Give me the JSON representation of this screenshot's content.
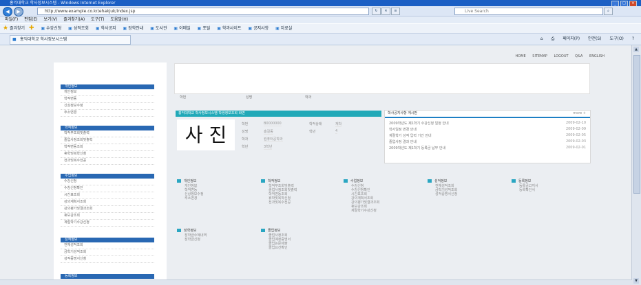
{
  "browser": {
    "title": "홍익대학교 학사정보시스템 - Windows Internet Explorer",
    "address": "http://www.example.co.kr/ehakjuk/index.jsp",
    "search_placeholder": "Live Search",
    "menu": [
      "파일(F)",
      "편집(E)",
      "보기(V)",
      "즐겨찾기(A)",
      "도구(T)",
      "도움말(H)"
    ],
    "favorites_label": "즐겨찾기",
    "favorites": [
      "수강신청",
      "성적조회",
      "학사공지",
      "장학안내",
      "도서관",
      "이메일",
      "포털",
      "학과사이트",
      "공지사항",
      "자료실"
    ],
    "tab_title": "홍익대학교 학사정보시스템",
    "tools": [
      "페이지(P)",
      "안전(S)",
      "도구(O)"
    ]
  },
  "page": {
    "top_links": [
      "HOME",
      "SITEMAP",
      "LOGOUT",
      "Q&A",
      "ENGLISH"
    ],
    "sidebar": [
      {
        "head": "개인정보",
        "items": [
          "개인정보",
          "학적변동",
          "신상정보수정",
          "주소변경"
        ]
      },
      {
        "head": "학적정보",
        "items": [
          "학적부조회및출력",
          "졸업사정조회및출력",
          "학적변동조회",
          "휴학및복학신청",
          "전과및복수전공"
        ]
      },
      {
        "head": "수업정보",
        "items": [
          "수강신청",
          "수강신청확인",
          "시간표조회",
          "강의계획서조회",
          "강의평가및결과조회",
          "휴보강조회",
          "계절학기수강신청"
        ]
      },
      {
        "head": "성적정보",
        "items": [
          "전체성적조회",
          "금학기성적조회",
          "성적증명서신청"
        ]
      },
      {
        "head": "등록정보",
        "items": []
      }
    ],
    "breadcrumb": [
      "학번",
      "성명",
      "학과"
    ],
    "profile": {
      "header": "홍익대학교 학사정보시스템 학생정보조회 화면",
      "photo_text": "사 진",
      "fields": [
        {
          "label": "학번",
          "value": "B0000000"
        },
        {
          "label": "성명",
          "value": "홍길동"
        },
        {
          "label": "학과",
          "value": "컴퓨터공학과"
        },
        {
          "label": "학년",
          "value": "3학년"
        }
      ],
      "extra": [
        {
          "label": "학적상태",
          "value": "재학"
        },
        {
          "label": "학년",
          "value": "4"
        }
      ]
    },
    "notice": {
      "title": "학사공지사항 게시판",
      "more": "more +",
      "rows": [
        {
          "text": "2009학년도 제1학기 수강신청 일정 안내",
          "date": "2009-02-10"
        },
        {
          "text": "학사일정 변경 안내",
          "date": "2009-02-09"
        },
        {
          "text": "계절학기 성적 입력 기간 안내",
          "date": "2009-02-05"
        },
        {
          "text": "졸업사정 결과 안내",
          "date": "2009-02-03"
        },
        {
          "text": "2009학년도 제1학기 등록금 납부 안내",
          "date": "2009-02-01"
        }
      ]
    },
    "groups": [
      {
        "head": "개인정보",
        "items": [
          "개인정보",
          "학적변동",
          "신상정보수정",
          "주소변경"
        ]
      },
      {
        "head": "학적정보",
        "items": [
          "학적부조회및출력",
          "졸업사정조회및출력",
          "학적변동조회",
          "휴학및복학신청",
          "전과및복수전공"
        ]
      },
      {
        "head": "수업정보",
        "items": [
          "수강신청",
          "수강신청확인",
          "시간표조회",
          "강의계획서조회",
          "강의평가및결과조회",
          "휴보강조회",
          "계절학기수강신청"
        ]
      },
      {
        "head": "성적정보",
        "items": [
          "전체성적조회",
          "금학기성적조회",
          "성적증명서신청"
        ]
      },
      {
        "head": "등록정보",
        "items": [
          "등록금고지서",
          "등록확인서"
        ]
      },
      {
        "head": "장학정보",
        "items": [
          "장학금수혜내역",
          "장학금신청"
        ]
      },
      {
        "head": "졸업정보",
        "items": [
          "졸업사정조회",
          "졸업예정증명서",
          "졸업논문제출",
          "졸업요건확인"
        ]
      }
    ]
  }
}
